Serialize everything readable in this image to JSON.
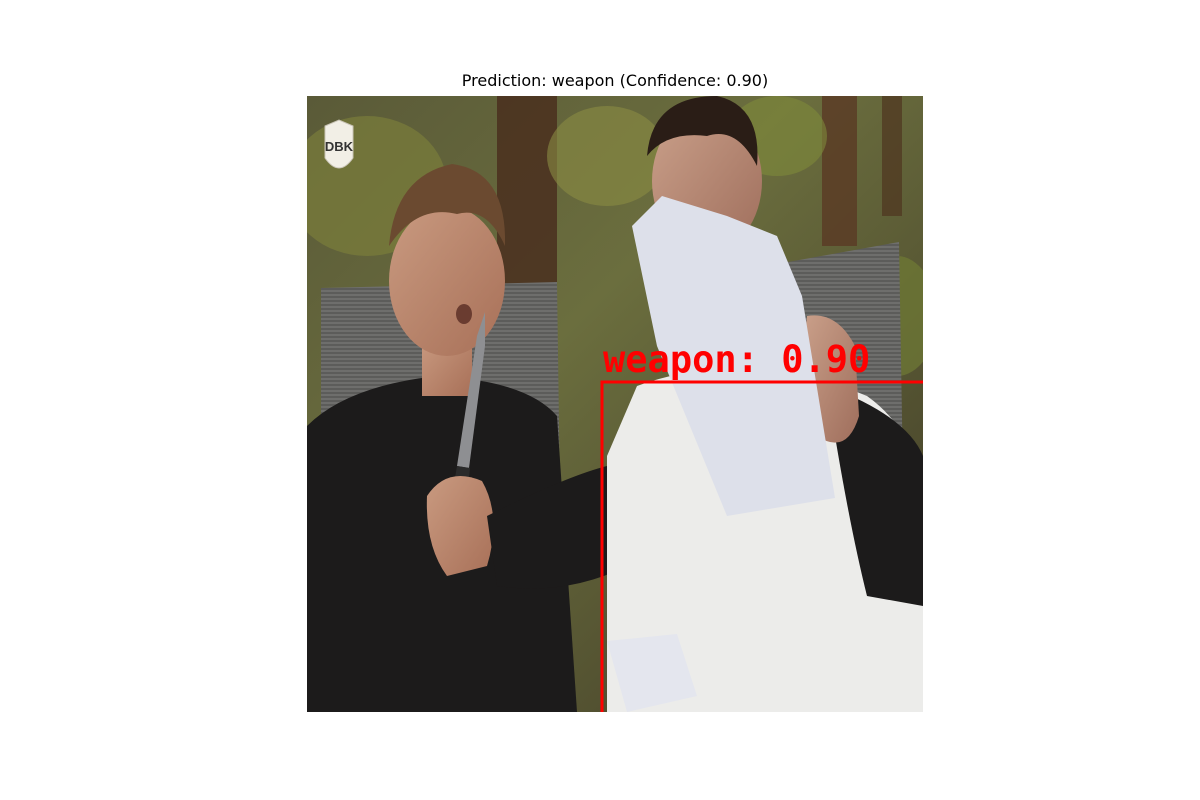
{
  "figure": {
    "title": "Prediction: weapon (Confidence: 0.90)"
  },
  "image": {
    "watermark_text": "DBK"
  },
  "detection": {
    "label": "weapon: 0.90",
    "class": "weapon",
    "confidence": 0.9,
    "box_color": "#ff0000"
  }
}
